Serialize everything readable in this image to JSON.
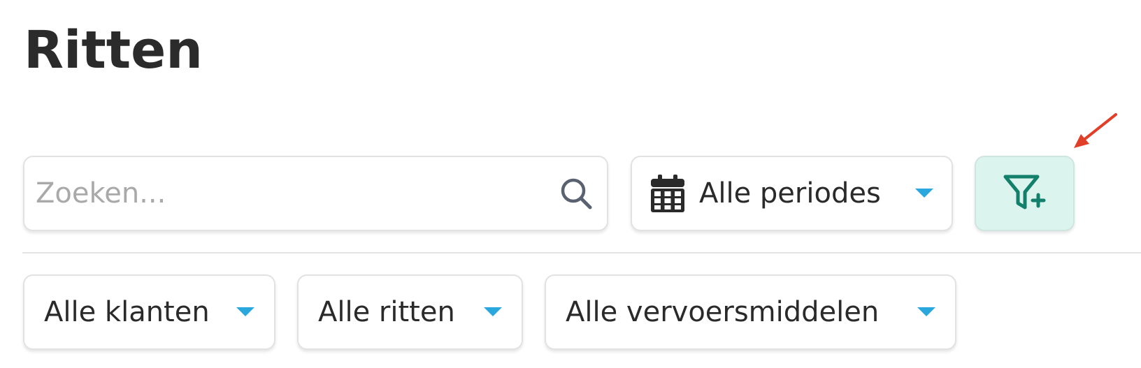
{
  "page": {
    "title": "Ritten"
  },
  "search": {
    "placeholder": "Zoeken...",
    "value": "",
    "icon": "search-icon"
  },
  "period_filter": {
    "label": "Alle periodes",
    "icon": "calendar-icon"
  },
  "add_filter_button": {
    "icon": "filter-plus-icon",
    "background_color": "#dcf4ee",
    "icon_color": "#12806a"
  },
  "filters": [
    {
      "label": "Alle klanten"
    },
    {
      "label": "Alle ritten"
    },
    {
      "label": "Alle vervoersmiddelen"
    }
  ],
  "colors": {
    "caret": "#2aa7dc",
    "annotation_arrow": "#e0402a",
    "text": "#2a2a2a"
  }
}
